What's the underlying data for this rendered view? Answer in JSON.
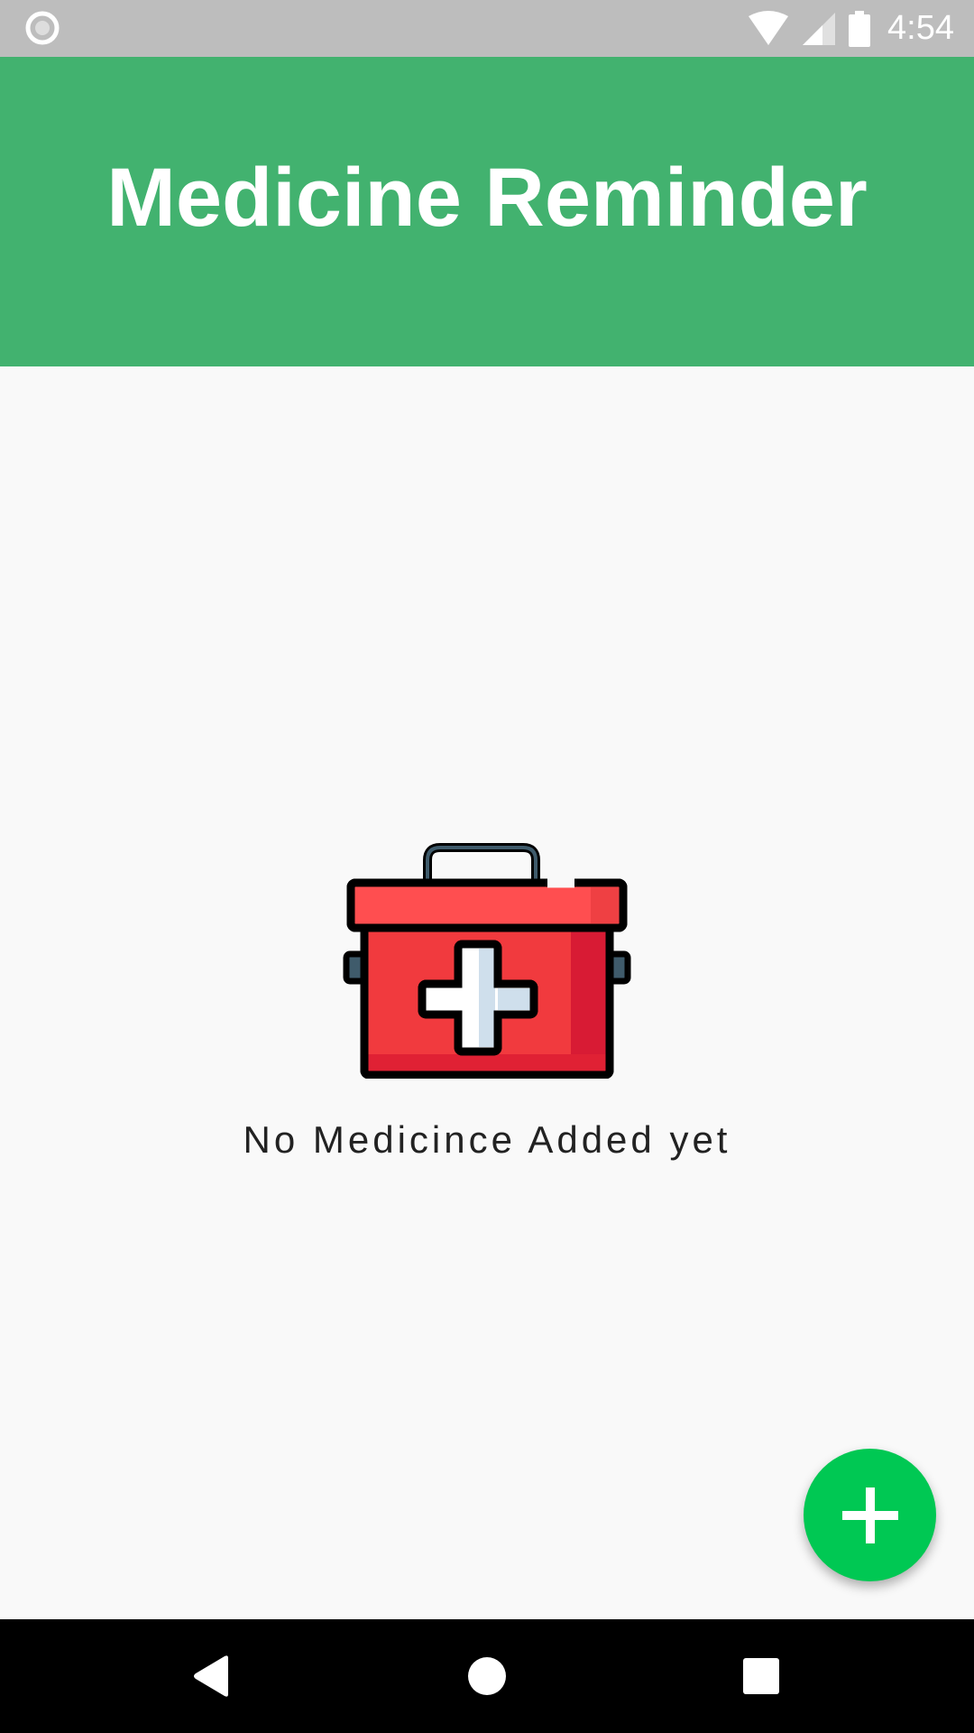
{
  "status_bar": {
    "time": "4:54",
    "icons": [
      "record-icon",
      "wifi-icon",
      "signal-icon",
      "battery-icon"
    ]
  },
  "app_bar": {
    "title": "Medicine Reminder",
    "color": "#42b26f"
  },
  "empty_state": {
    "icon": "first-aid-kit-icon",
    "message": "No Medicince Added yet"
  },
  "fab": {
    "icon": "plus-icon",
    "color": "#00c853"
  },
  "nav_bar": {
    "buttons": [
      "back-icon",
      "home-icon",
      "recents-icon"
    ]
  }
}
